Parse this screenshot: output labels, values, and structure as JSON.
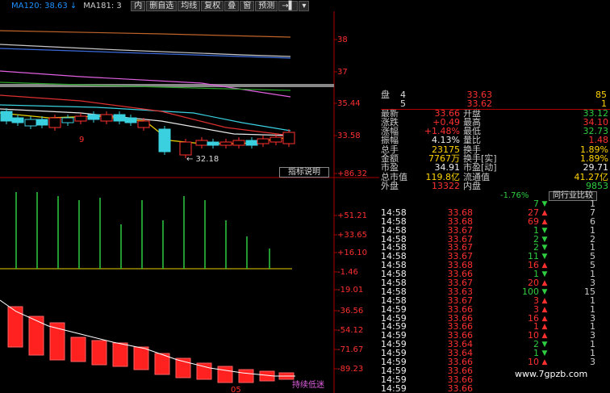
{
  "topbar": {
    "ma120": "MA120: 38.63 ↓",
    "ma181": "MA181: 3",
    "buttons": [
      "内",
      "删自选",
      "均线",
      "复权",
      "叠",
      "窗",
      "预测",
      "→▌",
      "▾"
    ]
  },
  "price_axis": [
    "38",
    "37",
    "35.44",
    "33.58"
  ],
  "kline_labels": {
    "nine": "9",
    "low_label": "← 32.18"
  },
  "badge": "指标说明",
  "indicator_axis": [
    "+86.32",
    "+51.21",
    "+33.65",
    "+16.10",
    "-1.46",
    "-19.01",
    "-36.56",
    "-54.12",
    "-71.67",
    "-89.23"
  ],
  "indicator_bottom_label": "05",
  "indicator_tag": "持续低迷",
  "quote": {
    "order_book": [
      {
        "lbl": "盘",
        "idx": "4",
        "price": "33.63",
        "vol": "85"
      },
      {
        "lbl": "",
        "idx": "5",
        "price": "33.62",
        "vol": "1"
      }
    ],
    "rows": [
      {
        "l1": "最新",
        "v1": "33.66",
        "c1": "red",
        "l2": "开盘",
        "v2": "33.12",
        "c2": "green"
      },
      {
        "l1": "涨跌",
        "v1": "+0.49",
        "c1": "red",
        "l2": "最高",
        "v2": "34.10",
        "c2": "red"
      },
      {
        "l1": "涨幅",
        "v1": "+1.48%",
        "c1": "red",
        "l2": "最低",
        "v2": "32.73",
        "c2": "green"
      },
      {
        "l1": "振幅",
        "v1": "4.13%",
        "c1": "white",
        "l2": "量比",
        "v2": "1.48",
        "c2": "red"
      },
      {
        "l1": "总手",
        "v1": "23175",
        "c1": "yellow",
        "l2": "换手",
        "v2": "1.89%",
        "c2": "yellow"
      },
      {
        "l1": "金额",
        "v1": "7767万",
        "c1": "yellow",
        "l2": "换手[实]",
        "v2": "1.89%",
        "c2": "yellow"
      },
      {
        "l1": "市盈",
        "v1": "34.91",
        "c1": "white",
        "l2": "市盈[动]",
        "v2": "29.71",
        "c2": "white"
      },
      {
        "l1": "总市值",
        "v1": "119.8亿",
        "c1": "yellow",
        "l2": "流通值",
        "v2": "41.27亿",
        "c2": "yellow"
      },
      {
        "l1": "外盘",
        "v1": "13322",
        "c1": "red",
        "l2": "内盘",
        "v2": "9853",
        "c2": "green"
      }
    ],
    "pct_change": "-1.76%",
    "compare_button": "同行业比较"
  },
  "trades": [
    {
      "time": "",
      "price": "",
      "vol": "7",
      "dir": "down",
      "n": "1"
    },
    {
      "time": "14:58",
      "price": "33.68",
      "vol": "27",
      "dir": "up",
      "n": "7"
    },
    {
      "time": "14:58",
      "price": "33.68",
      "vol": "69",
      "dir": "up",
      "n": "6"
    },
    {
      "time": "14:58",
      "price": "33.67",
      "vol": "1",
      "dir": "down",
      "n": "1"
    },
    {
      "time": "14:58",
      "price": "33.67",
      "vol": "2",
      "dir": "down",
      "n": "2"
    },
    {
      "time": "14:58",
      "price": "33.67",
      "vol": "2",
      "dir": "down",
      "n": "1"
    },
    {
      "time": "14:58",
      "price": "33.67",
      "vol": "11",
      "dir": "down",
      "n": "5"
    },
    {
      "time": "14:58",
      "price": "33.68",
      "vol": "16",
      "dir": "up",
      "n": "5"
    },
    {
      "time": "14:58",
      "price": "33.66",
      "vol": "1",
      "dir": "down",
      "n": "1"
    },
    {
      "time": "14:58",
      "price": "33.67",
      "vol": "20",
      "dir": "up",
      "n": "3"
    },
    {
      "time": "14:58",
      "price": "33.63",
      "vol": "100",
      "dir": "down",
      "n": "15"
    },
    {
      "time": "14:58",
      "price": "33.67",
      "vol": "3",
      "dir": "up",
      "n": "1"
    },
    {
      "time": "14:59",
      "price": "33.66",
      "vol": "3",
      "dir": "up",
      "n": "1"
    },
    {
      "time": "14:59",
      "price": "33.66",
      "vol": "16",
      "dir": "up",
      "n": "3"
    },
    {
      "time": "14:59",
      "price": "33.66",
      "vol": "1",
      "dir": "up",
      "n": "1"
    },
    {
      "time": "14:59",
      "price": "33.66",
      "vol": "10",
      "dir": "up",
      "n": "3"
    },
    {
      "time": "14:59",
      "price": "33.64",
      "vol": "2",
      "dir": "down",
      "n": "1"
    },
    {
      "time": "14:59",
      "price": "33.64",
      "vol": "1",
      "dir": "down",
      "n": "1"
    },
    {
      "time": "14:59",
      "price": "33.66",
      "vol": "10",
      "dir": "up",
      "n": "3"
    },
    {
      "time": "14:59",
      "price": "33.66",
      "vol": "",
      "dir": "",
      "n": ""
    },
    {
      "time": "14:59",
      "price": "33.66",
      "vol": "",
      "dir": "",
      "n": ""
    },
    {
      "time": "14:59",
      "price": "33.66",
      "vol": "",
      "dir": "",
      "n": ""
    },
    {
      "time": "14:59",
      "price": "33.66",
      "vol": "",
      "dir": "",
      "n": ""
    }
  ],
  "watermark": "www.7gpzb.com",
  "colors": {
    "up": "#ff3030",
    "down": "#2ecc40",
    "accent": "#ffd400"
  }
}
